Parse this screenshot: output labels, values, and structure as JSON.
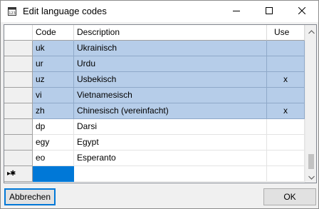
{
  "window": {
    "title": "Edit language codes",
    "icon": "dialog-app-icon",
    "controls": [
      "minimize-icon",
      "maximize-icon",
      "close-icon"
    ]
  },
  "grid": {
    "columns": [
      "Code",
      "Description",
      "Use"
    ],
    "rows": [
      {
        "code": "uk",
        "description": "Ukrainisch",
        "use": "",
        "selected": true
      },
      {
        "code": "ur",
        "description": "Urdu",
        "use": "",
        "selected": true
      },
      {
        "code": "uz",
        "description": "Usbekisch",
        "use": "x",
        "selected": true
      },
      {
        "code": "vi",
        "description": "Vietnamesisch",
        "use": "",
        "selected": true
      },
      {
        "code": "zh",
        "description": "Chinesisch (vereinfacht)",
        "use": "x",
        "selected": true
      },
      {
        "code": "dp",
        "description": "Darsi",
        "use": "",
        "selected": false
      },
      {
        "code": "egy",
        "description": "Egypt",
        "use": "",
        "selected": false
      },
      {
        "code": "eo",
        "description": "Esperanto",
        "use": "",
        "selected": false
      }
    ],
    "new_row_indicator": "▸✱"
  },
  "buttons": {
    "cancel_label": "Abbrechen",
    "ok_label": "OK"
  },
  "colors": {
    "selection": "#b6cde9",
    "focus": "#0078d7"
  }
}
